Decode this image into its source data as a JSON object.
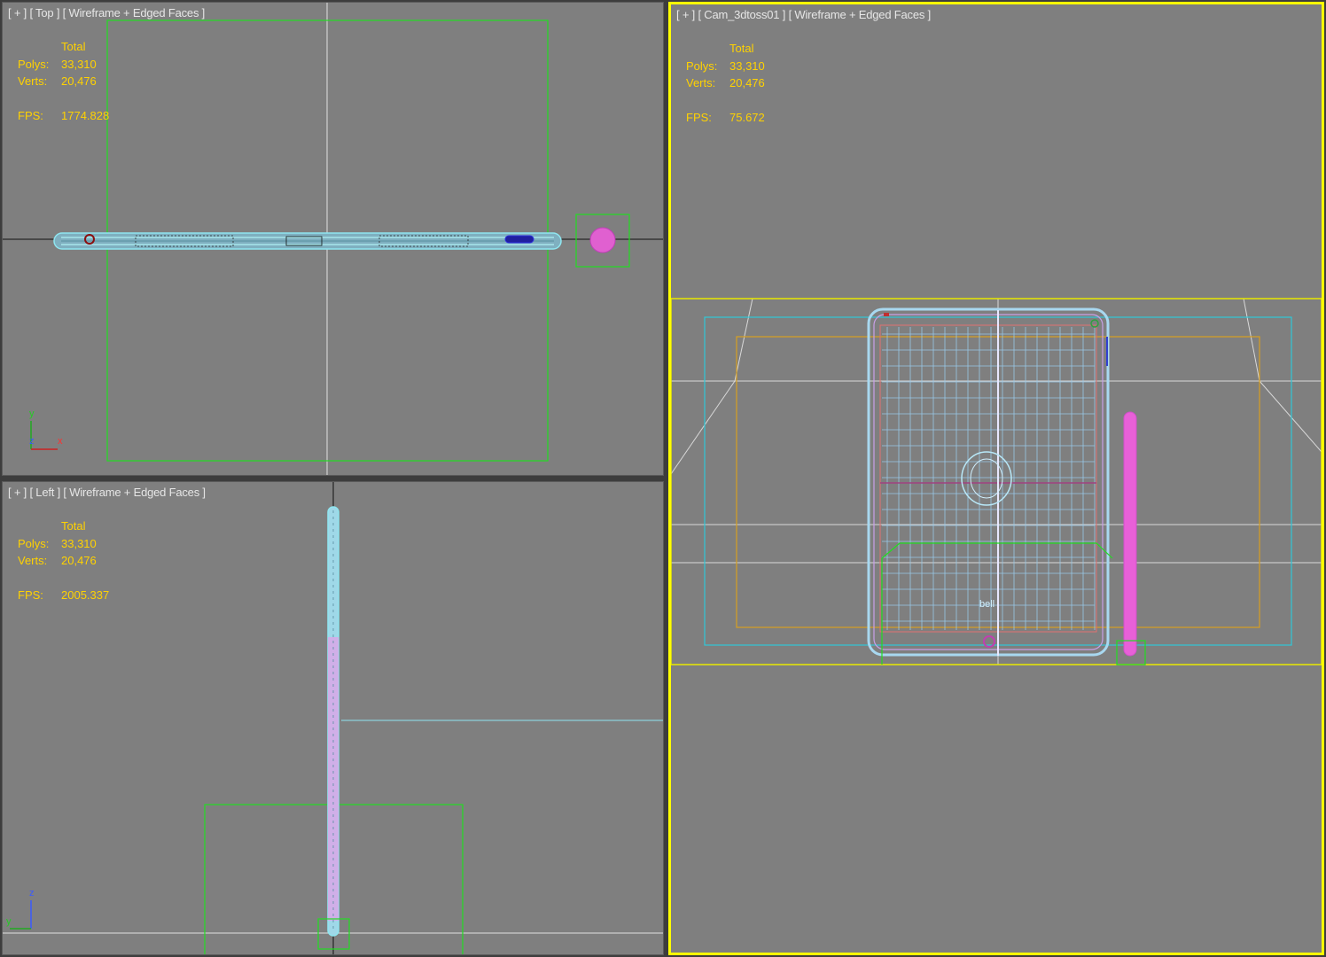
{
  "viewports": [
    {
      "id": "top",
      "label": {
        "plus": "[ + ]",
        "view": "[ Top ]",
        "shading": "[ Wireframe + Edged Faces ]"
      },
      "stats": {
        "header": "Total",
        "polys_label": "Polys:",
        "polys": "33,310",
        "verts_label": "Verts:",
        "verts": "20,476",
        "fps_label": "FPS:",
        "fps": "1774.828"
      },
      "axes": [
        "y",
        "z",
        "x"
      ]
    },
    {
      "id": "left",
      "label": {
        "plus": "[ + ]",
        "view": "[ Left ]",
        "shading": "[ Wireframe + Edged Faces ]"
      },
      "stats": {
        "header": "Total",
        "polys_label": "Polys:",
        "polys": "33,310",
        "verts_label": "Verts:",
        "verts": "20,476",
        "fps_label": "FPS:",
        "fps": "2005.337"
      },
      "axes": [
        "z",
        "y"
      ]
    },
    {
      "id": "camera",
      "active": true,
      "label": {
        "plus": "[ + ]",
        "view": "[ Cam_3dtoss01 ]",
        "shading": "[ Wireframe + Edged Faces ]"
      },
      "stats": {
        "header": "Total",
        "polys_label": "Polys:",
        "polys": "33,310",
        "verts_label": "Verts:",
        "verts": "20,476",
        "fps_label": "FPS:",
        "fps": "75.672"
      }
    }
  ],
  "colors": {
    "viewport_bg": "#7f7f7f",
    "active_border": "#ffff00",
    "stats_text": "#ffd200",
    "label_text": "#e6e6e6",
    "wire_cyan": "#8fe6f0",
    "wire_magenta": "#e860d8",
    "selection_green": "#22dd22",
    "camera_frame_yellow": "#e8e800",
    "safe_frame_orange": "#d8a020"
  },
  "model_label": "bell"
}
